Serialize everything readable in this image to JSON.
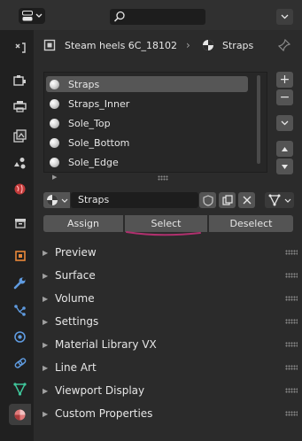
{
  "header": {
    "search_icon": "search-icon",
    "editor_icon": "editor-type-icon",
    "menu_icon": "chevron-down-icon"
  },
  "sidebar": {
    "tabs": [
      {
        "name": "tool",
        "icon": "tool-icon"
      },
      {
        "name": "render",
        "icon": "render-icon"
      },
      {
        "name": "output",
        "icon": "output-icon"
      },
      {
        "name": "view-layer",
        "icon": "view-layer-icon"
      },
      {
        "name": "scene",
        "icon": "scene-icon"
      },
      {
        "name": "world",
        "icon": "world-icon"
      },
      {
        "name": "collection",
        "icon": "collection-icon"
      },
      {
        "name": "object",
        "icon": "object-icon"
      },
      {
        "name": "modifiers",
        "icon": "wrench-icon"
      },
      {
        "name": "particles",
        "icon": "particles-icon"
      },
      {
        "name": "physics",
        "icon": "physics-icon"
      },
      {
        "name": "constraints",
        "icon": "constraints-icon"
      },
      {
        "name": "data",
        "icon": "mesh-data-icon"
      },
      {
        "name": "material",
        "icon": "material-icon",
        "active": true
      }
    ]
  },
  "breadcrumb": {
    "object": "Steam heels 6C_18102",
    "material": "Straps"
  },
  "material_slots": [
    "Straps",
    "Straps_Inner",
    "Sole_Top",
    "Sole_Bottom",
    "Sole_Edge"
  ],
  "selected_slot": "Straps",
  "slot_controls": {
    "add": "+",
    "remove": "−"
  },
  "material_field": {
    "value": "Straps"
  },
  "actions": {
    "assign": "Assign",
    "select": "Select",
    "deselect": "Deselect"
  },
  "panels": [
    "Preview",
    "Surface",
    "Volume",
    "Settings",
    "Material Library VX",
    "Line Art",
    "Viewport Display",
    "Custom Properties"
  ],
  "colors": {
    "background": "#2b2b2b",
    "sidebar": "#202020",
    "button": "#545454",
    "selection": "#565656",
    "annotation": "#b0306e"
  }
}
